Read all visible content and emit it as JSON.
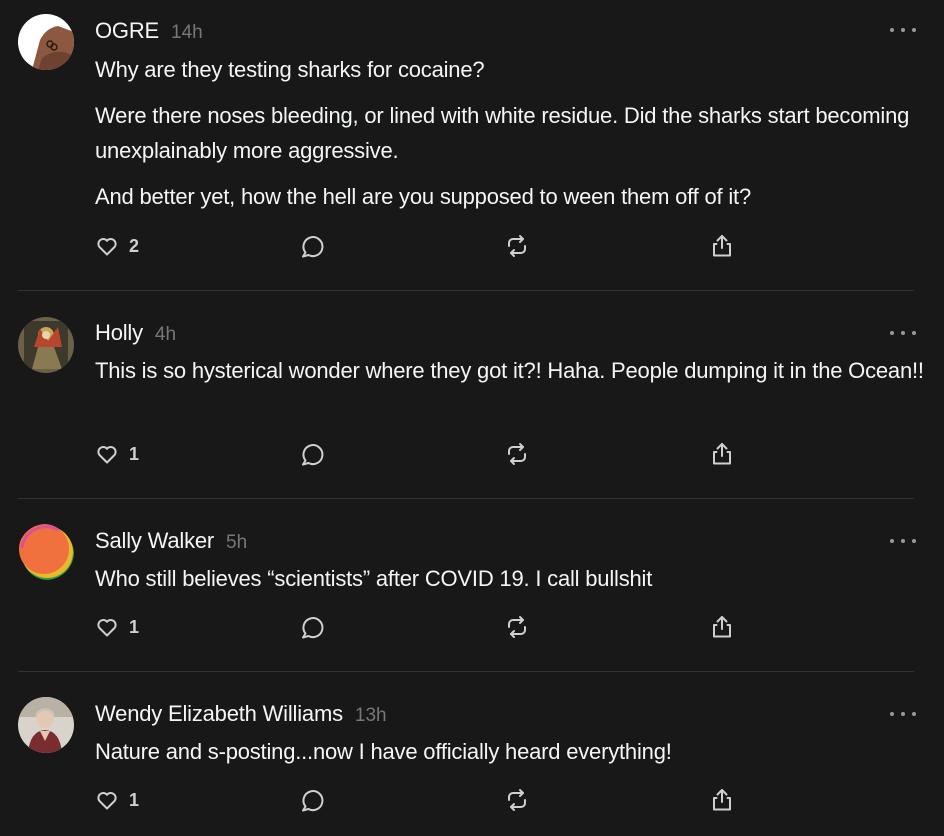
{
  "colors": {
    "background": "#181818",
    "text": "#f3f5f7",
    "muted": "#777777",
    "icon": "#cfcfcf",
    "divider": "#323232"
  },
  "icons": {
    "like": "heart-icon",
    "reply": "comment-bubble-icon",
    "repost": "repost-icon",
    "share": "share-icon",
    "more": "more-dots-icon"
  },
  "posts": [
    {
      "username": "OGRE",
      "time": "14h",
      "paragraphs": [
        "Why are they testing sharks for cocaine?",
        "Were there noses bleeding, or lined with white residue. Did the sharks start becoming unexplainably more aggressive.",
        "And better yet, how the hell are you supposed to ween them off of it?"
      ],
      "likes": "2"
    },
    {
      "username": "Holly",
      "time": "4h",
      "paragraphs": [
        "This is so hysterical wonder where they got it?! Haha. People dumping it in the Ocean!!"
      ],
      "likes": "1"
    },
    {
      "username": "Sally Walker",
      "time": "5h",
      "paragraphs": [
        "Who still believes “scientists” after COVID 19. I call bullshit"
      ],
      "likes": "1"
    },
    {
      "username": "Wendy Elizabeth Williams",
      "time": "13h",
      "paragraphs": [
        "Nature and s-posting...now I have officially heard everything!"
      ],
      "likes": "1"
    }
  ]
}
